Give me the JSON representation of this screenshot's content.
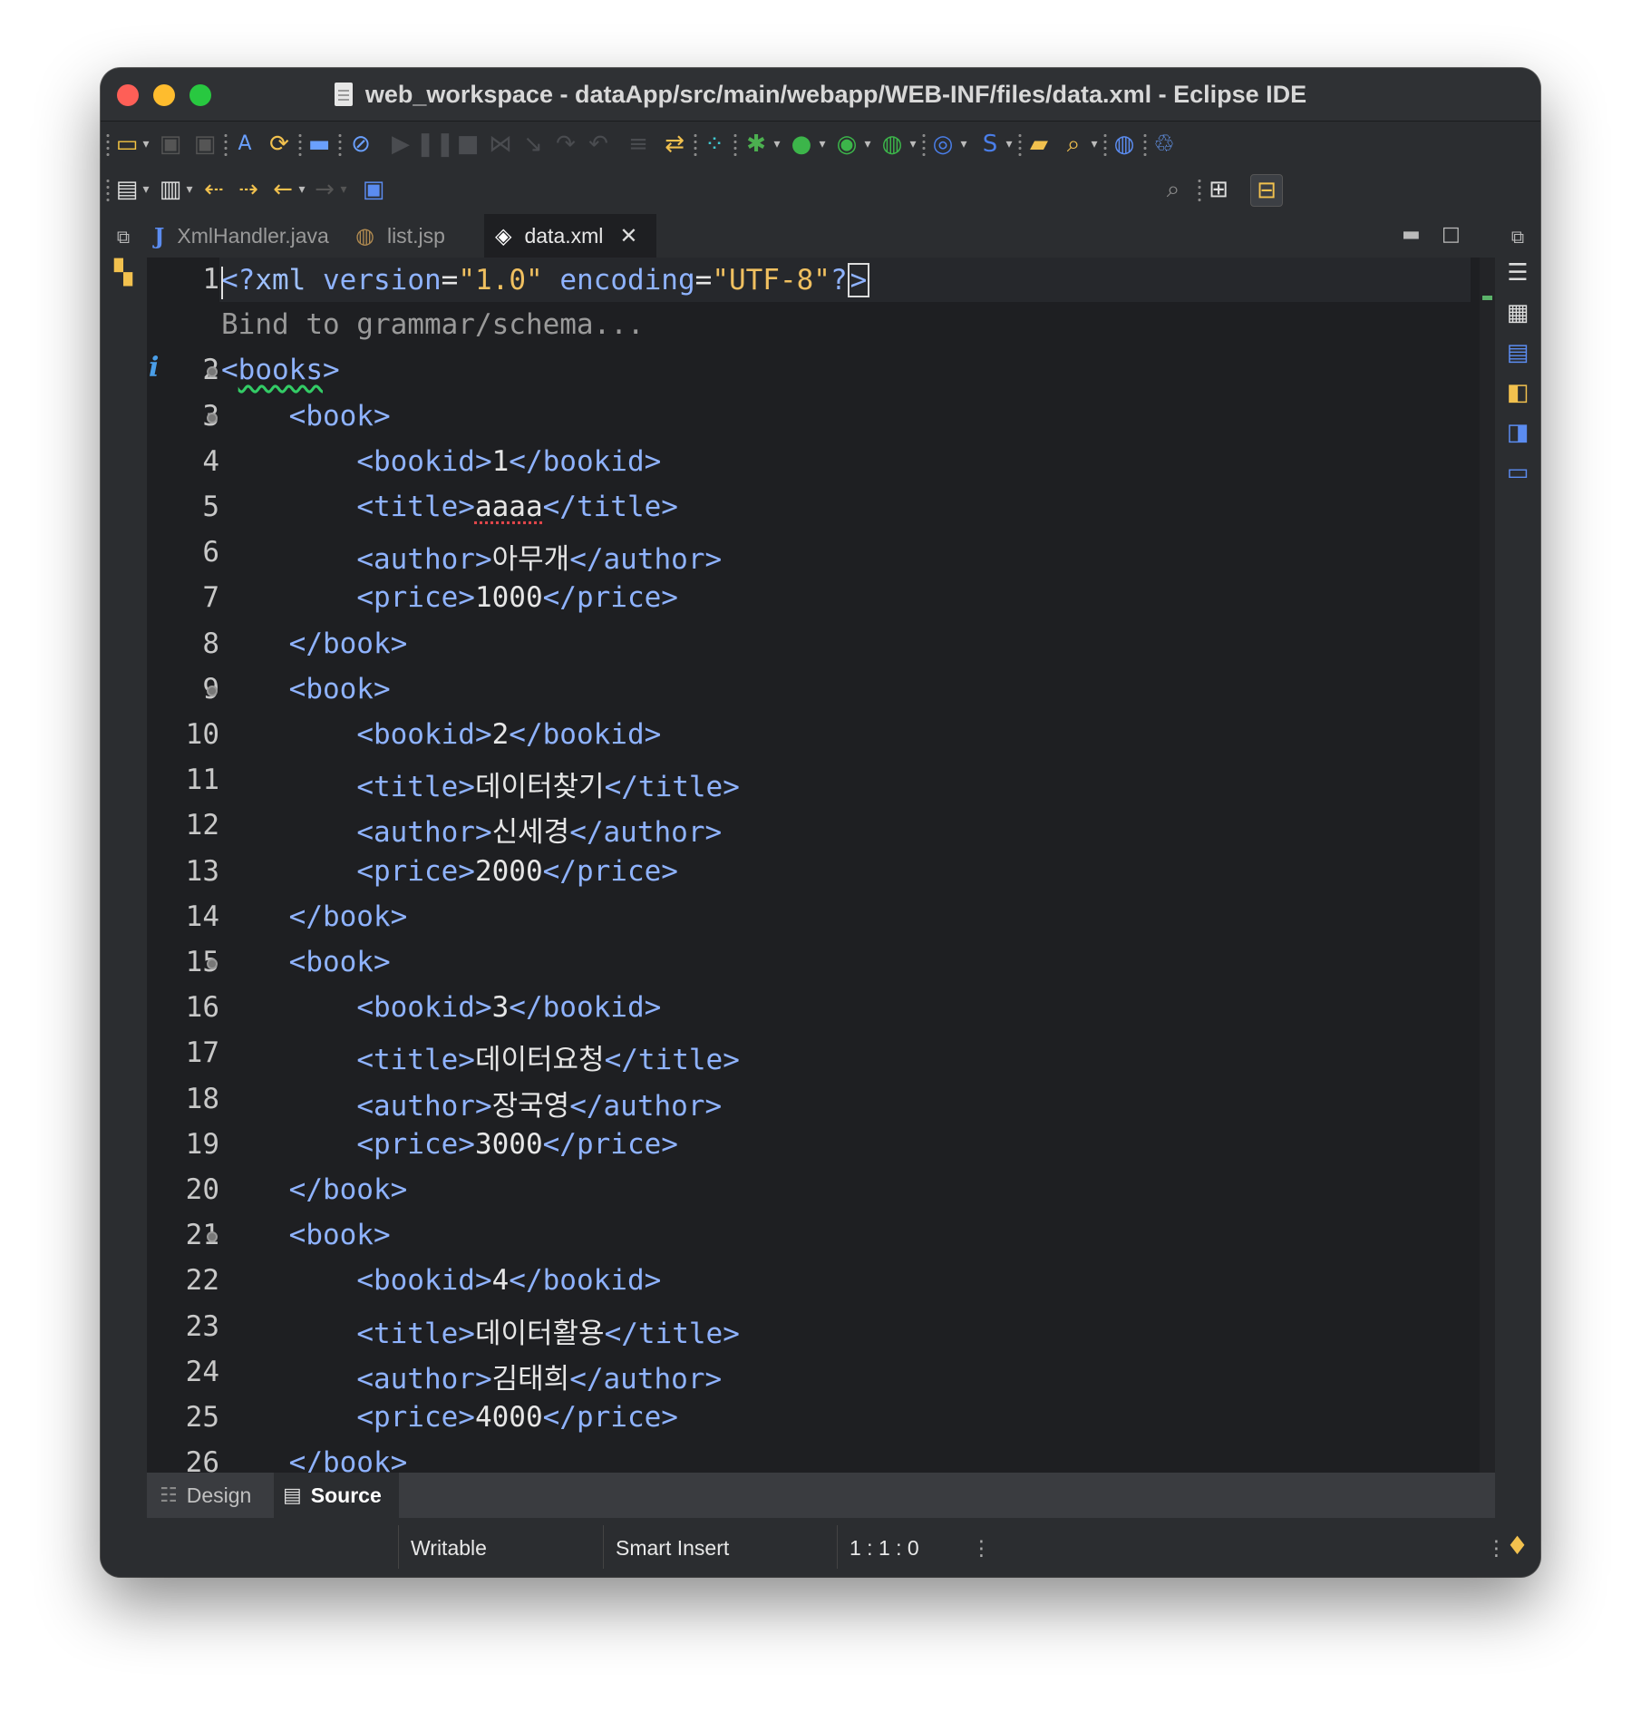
{
  "window": {
    "title": "web_workspace - dataApp/src/main/webapp/WEB-INF/files/data.xml - Eclipse IDE"
  },
  "toolbar_icons": {
    "row1": [
      "new-icon",
      "save-icon",
      "save-all-icon",
      "spell-check-icon",
      "sync-icon",
      "monitor-icon",
      "skip-breakpoints-icon",
      "resume-icon",
      "suspend-icon",
      "terminate-icon",
      "disconnect-icon",
      "step-into-icon",
      "step-over-icon",
      "step-return-icon",
      "drop-to-frame-icon",
      "use-step-filters-icon",
      "connection-icon",
      "debug-icon",
      "run-icon",
      "coverage-icon",
      "external-tools-icon",
      "web-service-icon",
      "new-spring-icon",
      "open-type-icon",
      "search-icon",
      "globe-icon",
      "boot-dashboard-icon"
    ],
    "row2": [
      "annotation-icon",
      "format-icon",
      "last-edit-icon",
      "next-annotation-icon",
      "back-icon",
      "forward-icon",
      "pin-editor-icon",
      "search-icon",
      "open-perspective-icon",
      "java-ee-perspective-icon"
    ]
  },
  "tabs": [
    {
      "label": "XmlHandler.java",
      "icon": "java-file-icon",
      "active": false
    },
    {
      "label": "list.jsp",
      "icon": "jsp-globe-icon",
      "active": false
    },
    {
      "label": "data.xml",
      "icon": "xml-file-icon",
      "active": true,
      "close": "✕"
    }
  ],
  "editor": {
    "hint": "Bind to grammar/schema...",
    "lines": [
      {
        "n": "1"
      },
      {
        "n": "2"
      },
      {
        "n": "3"
      },
      {
        "n": "4"
      },
      {
        "n": "5"
      },
      {
        "n": "6"
      },
      {
        "n": "7"
      },
      {
        "n": "8"
      },
      {
        "n": "9"
      },
      {
        "n": "10"
      },
      {
        "n": "11"
      },
      {
        "n": "12"
      },
      {
        "n": "13"
      },
      {
        "n": "14"
      },
      {
        "n": "15"
      },
      {
        "n": "16"
      },
      {
        "n": "17"
      },
      {
        "n": "18"
      },
      {
        "n": "19"
      },
      {
        "n": "20"
      },
      {
        "n": "21"
      },
      {
        "n": "22"
      },
      {
        "n": "23"
      },
      {
        "n": "24"
      },
      {
        "n": "25"
      },
      {
        "n": "26"
      }
    ],
    "xml_decl": {
      "version": "\"1.0\"",
      "encoding": "\"UTF-8\""
    },
    "books": [
      {
        "bookid": "1",
        "title": "aaaa",
        "author": "아무개",
        "price": "1000"
      },
      {
        "bookid": "2",
        "title": "데이터찾기",
        "author": "신세경",
        "price": "2000"
      },
      {
        "bookid": "3",
        "title": "데이터요청",
        "author": "장국영",
        "price": "3000"
      },
      {
        "bookid": "4",
        "title": "데이터활용",
        "author": "김태희",
        "price": "4000"
      }
    ]
  },
  "bottom_tabs": [
    {
      "label": "Design",
      "active": false
    },
    {
      "label": "Source",
      "active": true
    }
  ],
  "status": {
    "writable": "Writable",
    "insert_mode": "Smart Insert",
    "position": "1 : 1 : 0"
  }
}
